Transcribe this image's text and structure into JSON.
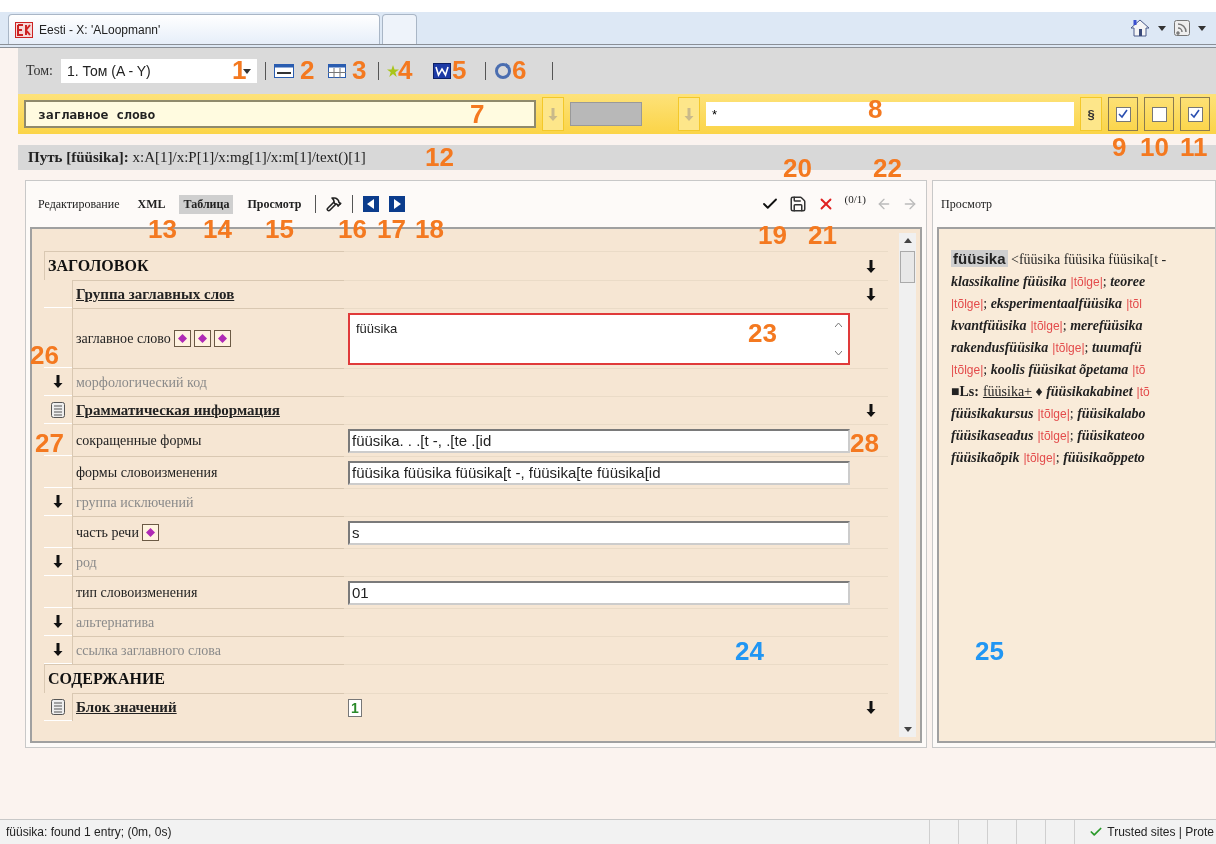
{
  "browser_tabs": [
    {
      "title": "Eesti - X: 'ALoopmann'",
      "selected": true
    },
    {
      "selected": false
    }
  ],
  "toolbar": {
    "volume_label": "Том:",
    "volume_value": "1. Том (A - Y)"
  },
  "search_bar": {
    "element_value": "заглавное слово",
    "pattern_value": "*",
    "section_button": "§",
    "checkboxes": [
      {
        "checked": true
      },
      {
        "checked": false
      },
      {
        "checked": true
      }
    ]
  },
  "path": "**Путь [füüsika]:** x:A[1]/x:P[1]/x:mg[1]/x:m[1]/text()[1]",
  "editor": {
    "tabs": [
      {
        "label": "Редактирование",
        "selected": false
      },
      {
        "label": "XML",
        "selected": false
      },
      {
        "label": "Таблица",
        "selected": true
      },
      {
        "label": "Просмотр",
        "selected": false
      }
    ],
    "counter": "(0/1)",
    "rows": [
      {
        "kind": "section",
        "label": "ЗАГОЛОВОК",
        "expand": true,
        "children": [
          {
            "kind": "group",
            "label": "Группа заглавных слов",
            "doc": false,
            "expand": true
          },
          {
            "kind": "field",
            "label": "заглавное слово",
            "markers": [
              {
                "kind": "diamond"
              },
              {
                "kind": "diamond"
              },
              {
                "kind": "diamond"
              }
            ],
            "value": "füüsika",
            "multiline": true,
            "focused": true
          },
          {
            "kind": "optional",
            "label": "морфологический код"
          },
          {
            "kind": "group",
            "label": "Грамматическая информация",
            "doc": true,
            "expand": true
          },
          {
            "kind": "field",
            "label": "сокращенные формы",
            "value": "füüsika. . .[t -, .[te .[id",
            "multiline": false,
            "focused": false
          },
          {
            "kind": "field",
            "label": "формы словоизменения",
            "value": "füüsika füüsika füüsika[t -, füüsika[te füüsika[id",
            "multiline": false,
            "focused": false
          },
          {
            "kind": "optional",
            "label": "группа исключений"
          },
          {
            "kind": "field",
            "label": "часть речи",
            "markers": [
              {
                "kind": "diamond"
              }
            ],
            "value": "s",
            "multiline": false,
            "focused": false
          },
          {
            "kind": "optional",
            "label": "род"
          },
          {
            "kind": "field",
            "label": "тип словоизменения",
            "value": "01",
            "multiline": false,
            "focused": false
          },
          {
            "kind": "optional",
            "label": "альтернатива"
          },
          {
            "kind": "optional",
            "label": "ссылка заглавного слова"
          }
        ]
      },
      {
        "kind": "section",
        "label": "СОДЕРЖАНИЕ",
        "expand": false,
        "children": [
          {
            "kind": "group",
            "label": "Блок значений",
            "doc": true,
            "expand": true,
            "count": "1"
          }
        ]
      }
    ]
  },
  "preview": {
    "title": "Просмотр",
    "lines": [
      [
        {
          "kind": "head",
          "text": "füüsika"
        },
        {
          "kind": "plain",
          "text": " <füüsika füüsika füüsika[t -"
        }
      ],
      [
        {
          "kind": "term",
          "text": "klassikaline füüsika"
        },
        {
          "kind": "red",
          "text": "|tõlge|"
        },
        {
          "kind": "plain",
          "text": "; "
        },
        {
          "kind": "term",
          "text": "teoree"
        }
      ],
      [
        {
          "kind": "red",
          "text": "|tõlge|"
        },
        {
          "kind": "plain",
          "text": "; "
        },
        {
          "kind": "term",
          "text": "eksperimentaalfüüsika"
        },
        {
          "kind": "red",
          "text": "|tõl"
        }
      ],
      [
        {
          "kind": "term",
          "text": "kvantfüüsika"
        },
        {
          "kind": "red",
          "text": "|tõlge|"
        },
        {
          "kind": "plain",
          "text": "; "
        },
        {
          "kind": "term",
          "text": "merefüüsika"
        }
      ],
      [
        {
          "kind": "term",
          "text": "rakendusfüüsika"
        },
        {
          "kind": "red",
          "text": "|tõlge|"
        },
        {
          "kind": "plain",
          "text": "; "
        },
        {
          "kind": "term",
          "text": "tuumafü"
        }
      ],
      [
        {
          "kind": "red",
          "text": "|tõlge|"
        },
        {
          "kind": "plain",
          "text": "; "
        },
        {
          "kind": "term",
          "text": "koolis füüsikat õpetama"
        },
        {
          "kind": "red",
          "text": "|tõ"
        }
      ],
      [
        {
          "kind": "strong",
          "text": "■Ls:"
        },
        {
          "kind": "link",
          "text": "füüsika+"
        },
        {
          "kind": "plain",
          "text": " ♦ "
        },
        {
          "kind": "term",
          "text": "füüsikakabinet"
        },
        {
          "kind": "red",
          "text": "|tõ"
        }
      ],
      [
        {
          "kind": "term",
          "text": "füüsikakursus"
        },
        {
          "kind": "red",
          "text": "|tõlge|"
        },
        {
          "kind": "plain",
          "text": "; "
        },
        {
          "kind": "term",
          "text": "füüsikalabo"
        }
      ],
      [
        {
          "kind": "term",
          "text": "füüsikaseadus"
        },
        {
          "kind": "red",
          "text": "|tõlge|"
        },
        {
          "kind": "plain",
          "text": "; "
        },
        {
          "kind": "term",
          "text": "füüsikateoo"
        }
      ],
      [
        {
          "kind": "term",
          "text": "füüsikaõpik"
        },
        {
          "kind": "red",
          "text": "|tõlge|"
        },
        {
          "kind": "plain",
          "text": "; "
        },
        {
          "kind": "term",
          "text": "füüsikaõppeto"
        }
      ]
    ]
  },
  "status_bar": {
    "message": "füüsika: found 1 entry; (0m, 0s)",
    "zone": "Trusted sites | Prote"
  },
  "callouts": [
    {
      "label": "1",
      "color": "#f47920"
    },
    {
      "label": "2",
      "color": "#f47920"
    },
    {
      "label": "3",
      "color": "#f47920"
    },
    {
      "label": "4",
      "color": "#f47920"
    },
    {
      "label": "5",
      "color": "#f47920"
    },
    {
      "label": "6",
      "color": "#f47920"
    },
    {
      "label": "7",
      "color": "#f47920"
    },
    {
      "label": "8",
      "color": "#f47920"
    },
    {
      "label": "9",
      "color": "#f47920"
    },
    {
      "label": "10",
      "color": "#f47920"
    },
    {
      "label": "11",
      "color": "#f47920"
    },
    {
      "label": "12",
      "color": "#f47920"
    },
    {
      "label": "13",
      "color": "#f47920"
    },
    {
      "label": "14",
      "color": "#f47920"
    },
    {
      "label": "15",
      "color": "#f47920"
    },
    {
      "label": "16",
      "color": "#f47920"
    },
    {
      "label": "17",
      "color": "#f47920"
    },
    {
      "label": "18",
      "color": "#f47920"
    },
    {
      "label": "19",
      "color": "#f47920"
    },
    {
      "label": "20",
      "color": "#f47920"
    },
    {
      "label": "21",
      "color": "#f47920"
    },
    {
      "label": "22",
      "color": "#f47920"
    },
    {
      "label": "23",
      "color": "#f47920"
    },
    {
      "label": "24",
      "color": "#2196f3"
    },
    {
      "label": "25",
      "color": "#2196f3"
    },
    {
      "label": "26",
      "color": "#f47920"
    },
    {
      "label": "27",
      "color": "#f47920"
    },
    {
      "label": "28",
      "color": "#f47920"
    }
  ]
}
